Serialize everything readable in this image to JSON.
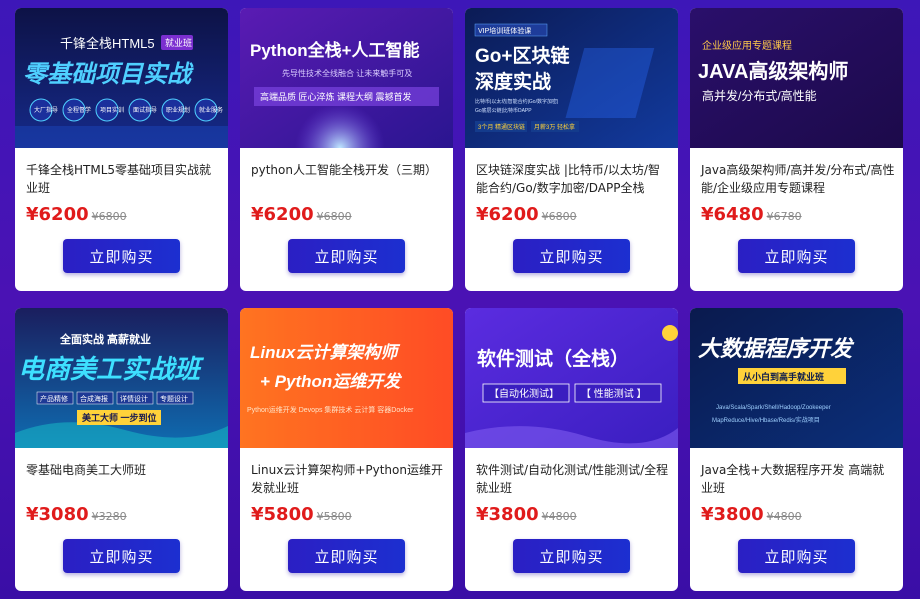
{
  "cards": [
    {
      "banner": {
        "line1": "千锋全栈HTML5",
        "tag": "就业班",
        "headline": "零基础项目实战",
        "badges": [
          "大厂指导",
          "全程督学",
          "项目实训",
          "面试指导",
          "职业规划",
          "就业服务"
        ]
      },
      "title": "千锋全栈HTML5零基础项目实战就业班",
      "price": "¥6200",
      "original_price": "¥6800",
      "button": "立即购买"
    },
    {
      "banner": {
        "headline": "Python全栈+人工智能",
        "sub": "先导性技术全线融合 让未来触手可及",
        "bar": "高端品质 匠心淬炼 课程大纲 震撼首发"
      },
      "title": "python人工智能全栈开发（三期）",
      "price": "¥6200",
      "original_price": "¥6800",
      "button": "立即购买"
    },
    {
      "banner": {
        "tag": "VIP培训班体验课",
        "line1": "Go+区块链",
        "line2": "深度实战",
        "desc1": "比特币|以太坊|智能合约|Go/数字加密|",
        "desc2": "Go底层公链|比特币DAPP",
        "bottom_a": "3个月 精通区块链",
        "bottom_b": "月薪3万 轻松拿"
      },
      "title": "区块链深度实战 |比特币/以太坊/智能合约/Go/数字加密/DAPP全栈",
      "price": "¥6200",
      "original_price": "¥6800",
      "button": "立即购买"
    },
    {
      "banner": {
        "tag": "企业级应用专题课程",
        "headline": "JAVA高级架构师",
        "sub": "高并发/分布式/高性能"
      },
      "title": "Java高级架构师/高并发/分布式/高性能/企业级应用专题课程",
      "price": "¥6480",
      "original_price": "¥6780",
      "button": "立即购买"
    },
    {
      "banner": {
        "line1": "全面实战 高薪就业",
        "headline": "电商美工实战班",
        "chips": [
          "产品精修",
          "合成海报",
          "详情设计",
          "专题设计"
        ],
        "slogan": "美工大师 一步到位"
      },
      "title": "零基础电商美工大师班",
      "price": "¥3080",
      "original_price": "¥3280",
      "button": "立即购买"
    },
    {
      "banner": {
        "line1": "Linux云计算架构师",
        "line2": "+ Python运维开发",
        "footer": "Python运维开发  Devops  集群技术  云计算  容器Docker"
      },
      "title": "Linux云计算架构师+Python运维开发就业班",
      "price": "¥5800",
      "original_price": "¥5800",
      "button": "立即购买"
    },
    {
      "banner": {
        "headline": "软件测试（全栈）",
        "tag_a": "【自动化测试】",
        "tag_b": "【 性能测试 】"
      },
      "title": "软件测试/自动化测试/性能测试/全程就业班",
      "price": "¥3800",
      "original_price": "¥4800",
      "button": "立即购买"
    },
    {
      "banner": {
        "headline": "大数据程序开发",
        "tag": "从小白到高手就业班",
        "tech1": "Java/Scala/Spark/Shell/Hadoop/Zookeeper",
        "tech2": "MapReduce/Hive/Hbase/Redis/实战项目"
      },
      "title": "Java全栈+大数据程序开发 高端就业班",
      "price": "¥3800",
      "original_price": "¥4800",
      "button": "立即购买"
    }
  ],
  "colors": {
    "background": "#4a12b4",
    "price": "#e01b1b",
    "button": "#2b1fc4"
  }
}
